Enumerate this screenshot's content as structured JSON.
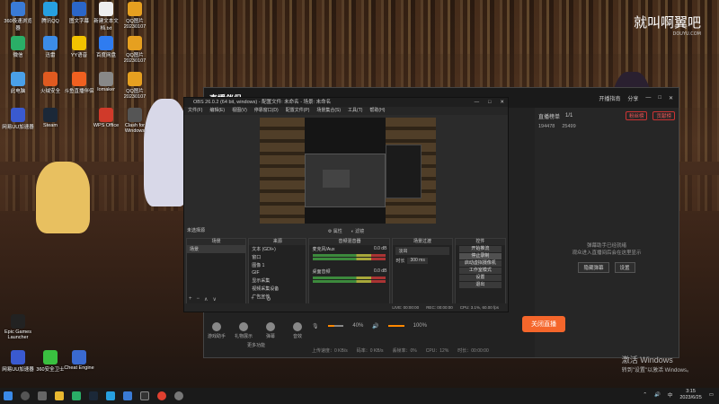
{
  "watermark": {
    "main": "就叫啊翼吧",
    "sub": "DOUYU.COM"
  },
  "activate": {
    "title": "激活 Windows",
    "sub": "转到\"设置\"以激活 Windows。"
  },
  "desktop_icons": [
    {
      "label": "360极速浏览器",
      "color": "#3a7bd5"
    },
    {
      "label": "腾讯QQ",
      "color": "#27a0e0"
    },
    {
      "label": "图文字幕",
      "color": "#2b66c8"
    },
    {
      "label": "新建文本文档.txt",
      "color": "#eee"
    },
    {
      "label": "QQ图片20230107",
      "color": "#e6a020"
    },
    {
      "label": "微信",
      "color": "#2aae67"
    },
    {
      "label": "迅雷",
      "color": "#3c8ce8"
    },
    {
      "label": "YY语音",
      "color": "#f2c200"
    },
    {
      "label": "百度网盘",
      "color": "#2f7cf0"
    },
    {
      "label": "QQ图片20230107",
      "color": "#e6a020"
    },
    {
      "label": "此电脑",
      "color": "#4aa0e8"
    },
    {
      "label": "火绒安全",
      "color": "#e05a20"
    },
    {
      "label": "斗鱼直播伴侣",
      "color": "#f06020"
    },
    {
      "label": "Iomaker",
      "color": "#888"
    },
    {
      "label": "QQ图片20230107",
      "color": "#e6a020"
    },
    {
      "label": "网易UU加速器",
      "color": "#3a5ad0"
    },
    {
      "label": "Steam",
      "color": "#1b2838"
    },
    {
      "label": "WPS Office",
      "color": "#d03a2a"
    },
    {
      "label": "Clash for Windows",
      "color": "#555"
    },
    {
      "label": "Epic Games Launcher",
      "color": "#222"
    },
    {
      "label": "360安全卫士",
      "color": "#3ac040"
    },
    {
      "label": "Cheat Engine",
      "color": "#3a6ad0"
    },
    {
      "label": "网易UU加速器",
      "color": "#3a5ad0"
    }
  ],
  "stream_app": {
    "logo": "直播伴侣",
    "header_buttons": [
      "开播指南",
      "分享"
    ],
    "right_title": "直播榜单",
    "right_page": "1/1",
    "right_btns": [
      "粉丝榜",
      "贡献榜"
    ],
    "stats": [
      "194478",
      "25499"
    ],
    "msg_line1": "弹幕助手已经就绪",
    "msg_line2": "观众进入直播间后会在这里显示",
    "msg_btns": [
      "隐藏弹幕",
      "设置"
    ],
    "tools": [
      "游戏助手",
      "礼物展示",
      "弹幕",
      "音效"
    ],
    "more": "更多功能",
    "mic_level": "40%",
    "speaker_level": "100%",
    "mic_fill": 0.4,
    "speaker_fill": 1.0,
    "go_live": "关闭直播",
    "status": [
      "上传速度：0 KB/s",
      "码率：0 KB/s",
      "丢帧率：0%",
      "CPU：12%",
      "时长：00:00:00"
    ]
  },
  "obs": {
    "title": "OBS 26.0.2 (64 bit, windows) - 配置文件: 未命名 - 场景: 未命名",
    "window_controls": [
      "—",
      "□",
      "✕"
    ],
    "menu": [
      "文件(F)",
      "编辑(E)",
      "视图(V)",
      "停靠窗口(D)",
      "配置文件(P)",
      "场景集合(S)",
      "工具(T)",
      "帮助(H)"
    ],
    "source_label": "未选择源",
    "mid_buttons": [
      "属性",
      "滤镜"
    ],
    "docks": {
      "scenes": {
        "title": "场景",
        "items": [
          "场景"
        ]
      },
      "sources": {
        "title": "来源",
        "items": [
          "文本 (GDI+)",
          "窗口",
          "图像 1",
          "GIF",
          "显示采集",
          "视频采集设备",
          "广告宣传"
        ]
      },
      "mixer": {
        "title": "音频混音器",
        "items": [
          {
            "name": "麦克风/Aux",
            "db": "0.0 dB"
          },
          {
            "name": "桌面音频",
            "db": "0.0 dB"
          }
        ]
      },
      "transitions": {
        "title": "场景过渡",
        "type": "淡出",
        "duration_label": "时长",
        "duration": "300 ms"
      },
      "controls": {
        "title": "控件",
        "buttons": [
          "开始推流",
          "停止录制",
          "启动虚拟摄像机",
          "工作室模式",
          "设置",
          "退出"
        ]
      }
    },
    "statusbar": [
      "LIVE: 00:00:00",
      "REC: 00:00:00",
      "CPU: 3.1%, 60.00 fps"
    ]
  },
  "taskbar": {
    "apps": [
      "开始",
      "搜索",
      "任务视图",
      "文件资源管理器",
      "微信",
      "Steam",
      "QQ",
      "浏览器",
      "OBS",
      "Chrome",
      "设置"
    ],
    "time": "3:15",
    "date": "2023/6/25",
    "lang": "中"
  }
}
